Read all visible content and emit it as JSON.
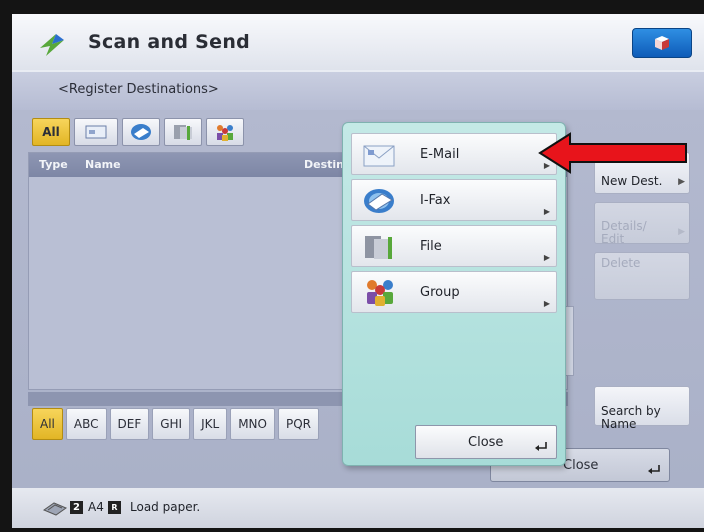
{
  "header": {
    "title": "Scan and Send"
  },
  "subheader": {
    "text": "<Register Destinations>"
  },
  "type_tabs": [
    {
      "label": "All",
      "icon": ""
    },
    {
      "label": "",
      "icon": "address-card-icon"
    },
    {
      "label": "",
      "icon": "ifax-icon"
    },
    {
      "label": "",
      "icon": "file-icon"
    },
    {
      "label": "",
      "icon": "group-icon"
    }
  ],
  "list": {
    "col_type": "Type",
    "col_name": "Name",
    "col_dest": "Destin"
  },
  "side_buttons": {
    "register": "New Dest.",
    "details": "Details/\nEdit",
    "delete": "Delete",
    "search": "Search by\nName"
  },
  "alpha_buttons": [
    "All",
    "ABC",
    "DEF",
    "GHI",
    "JKL",
    "MNO",
    "PQR"
  ],
  "behind_close_label": "Close",
  "popup": {
    "items": [
      {
        "label": "E-Mail",
        "icon": "email-icon"
      },
      {
        "label": "I-Fax",
        "icon": "ifax-icon"
      },
      {
        "label": "File",
        "icon": "file-icon"
      },
      {
        "label": "Group",
        "icon": "group-icon"
      }
    ],
    "close_label": "Close"
  },
  "status": {
    "paper_num": "2",
    "paper_size": "A4",
    "message": "Load paper."
  },
  "colors": {
    "accent_yellow": "#e9bf2e",
    "popup_teal": "#b5e2df",
    "home_blue": "#1e74d0",
    "annotation_red": "#e8141b"
  }
}
